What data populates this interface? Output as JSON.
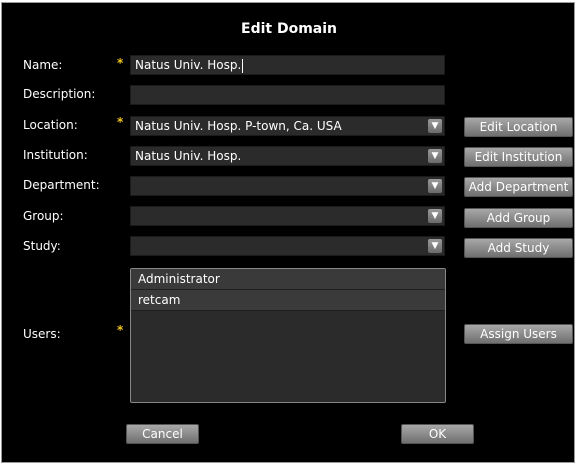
{
  "dialog": {
    "title": "Edit Domain"
  },
  "labels": {
    "name": "Name:",
    "description": "Description:",
    "location": "Location:",
    "institution": "Institution:",
    "department": "Department:",
    "group": "Group:",
    "study": "Study:",
    "users": "Users:"
  },
  "required_marker": "*",
  "fields": {
    "name": "Natus Univ. Hosp.",
    "description": "",
    "location": "Natus Univ. Hosp. P-town, Ca.  USA",
    "institution": "Natus Univ. Hosp.",
    "department": "",
    "group": "",
    "study": ""
  },
  "buttons": {
    "edit_location": "Edit Location",
    "edit_institution": "Edit Institution",
    "add_department": "Add Department",
    "add_group": "Add Group",
    "add_study": "Add Study",
    "assign_users": "Assign Users",
    "cancel": "Cancel",
    "ok": "OK"
  },
  "users": [
    "Administrator",
    "retcam"
  ],
  "colors": {
    "background": "#000000",
    "field": "#2b2b2b",
    "required": "#f2c61f",
    "button": "#8c8c8c"
  },
  "icons": {
    "dropdown": "chevron-down-icon"
  }
}
